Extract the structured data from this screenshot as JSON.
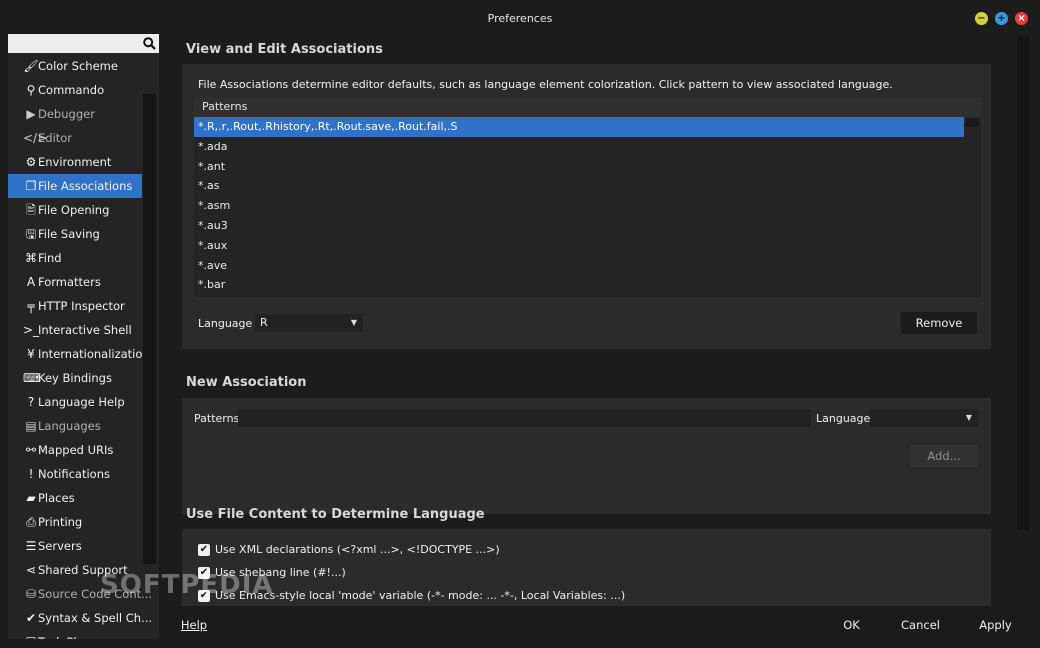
{
  "window": {
    "title": "Preferences",
    "min": "−",
    "max": "+",
    "close": "×"
  },
  "sidebar": {
    "items": [
      {
        "label": "Color Scheme",
        "icon": "🖌"
      },
      {
        "label": "Commando",
        "icon": "⚲"
      },
      {
        "label": "Debugger",
        "icon": "▶"
      },
      {
        "label": "Editor",
        "icon": "</>"
      },
      {
        "label": "Environment",
        "icon": "⚙"
      },
      {
        "label": "File Associations",
        "icon": "❐"
      },
      {
        "label": "File Opening",
        "icon": "🖹"
      },
      {
        "label": "File Saving",
        "icon": "🖫"
      },
      {
        "label": "Find",
        "icon": "⌘"
      },
      {
        "label": "Formatters",
        "icon": "A"
      },
      {
        "label": "HTTP Inspector",
        "icon": "╤"
      },
      {
        "label": "Interactive Shell",
        "icon": ">_"
      },
      {
        "label": "Internationalization",
        "icon": "¥"
      },
      {
        "label": "Key Bindings",
        "icon": "⌨"
      },
      {
        "label": "Language Help",
        "icon": "?"
      },
      {
        "label": "Languages",
        "icon": "▤"
      },
      {
        "label": "Mapped URIs",
        "icon": "⚯"
      },
      {
        "label": "Notifications",
        "icon": "!"
      },
      {
        "label": "Places",
        "icon": "▰"
      },
      {
        "label": "Printing",
        "icon": "⎙"
      },
      {
        "label": "Servers",
        "icon": "☰"
      },
      {
        "label": "Shared Support",
        "icon": "⋖"
      },
      {
        "label": "Source Code Cont...",
        "icon": "⛁"
      },
      {
        "label": "Syntax & Spell Ch...",
        "icon": "✔"
      },
      {
        "label": "Task Pl...",
        "icon": "☑"
      }
    ]
  },
  "associations": {
    "section_title": "View and Edit Associations",
    "description": "File Associations determine editor defaults, such as language element colorization. Click pattern to view associated language.",
    "patterns_header": "Patterns",
    "patterns": [
      "*.R,.r,.Rout,.Rhistory,.Rt,.Rout.save,.Rout.fail,.S",
      "*.ada",
      "*.ant",
      "*.as",
      "*.asm",
      "*.au3",
      "*.aux",
      "*.ave",
      "*.bar"
    ],
    "language_label": "Language",
    "language_value": "R",
    "remove_label": "Remove"
  },
  "new_association": {
    "section_title": "New Association",
    "patterns_label": "Patterns",
    "language_label": "Language",
    "add_label": "Add..."
  },
  "file_content": {
    "section_title": "Use File Content to Determine Language",
    "options": [
      {
        "label": "Use XML declarations (<?xml ...>, <!DOCTYPE ...>)",
        "checked": true
      },
      {
        "label": "Use shebang line (#!...)",
        "checked": true
      },
      {
        "label": "Use Emacs-style local 'mode' variable (-*- mode: ... -*-, Local Variables: ...)",
        "checked": true
      }
    ]
  },
  "footer": {
    "help": "Help",
    "ok": "OK",
    "cancel": "Cancel",
    "apply": "Apply"
  },
  "watermark": "SOFTPEDIA",
  "colors": {
    "accent": "#3072c8",
    "background": "#1c1c1c",
    "panel": "#2b2b2b"
  }
}
